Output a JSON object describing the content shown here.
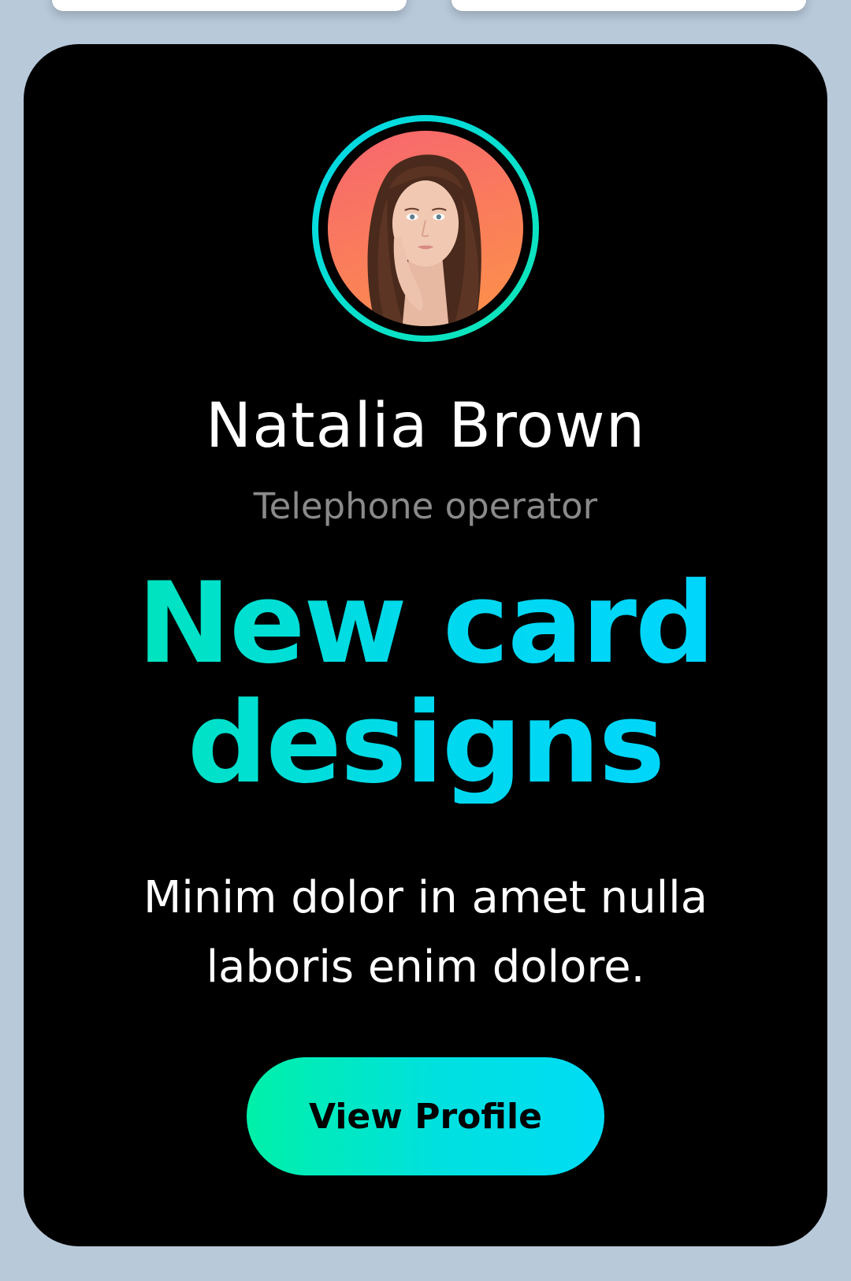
{
  "profile": {
    "name": "Natalia Brown",
    "role": "Telephone operator",
    "headline": "New card designs",
    "description": "Minim dolor in amet nulla laboris enim dolore.",
    "button_label": "View Profile"
  },
  "colors": {
    "background": "#b8c9da",
    "card": "#000000",
    "accent_start": "#00f0a8",
    "accent_end": "#00d4ff",
    "name_text": "#ffffff",
    "role_text": "#8a8a8a"
  }
}
